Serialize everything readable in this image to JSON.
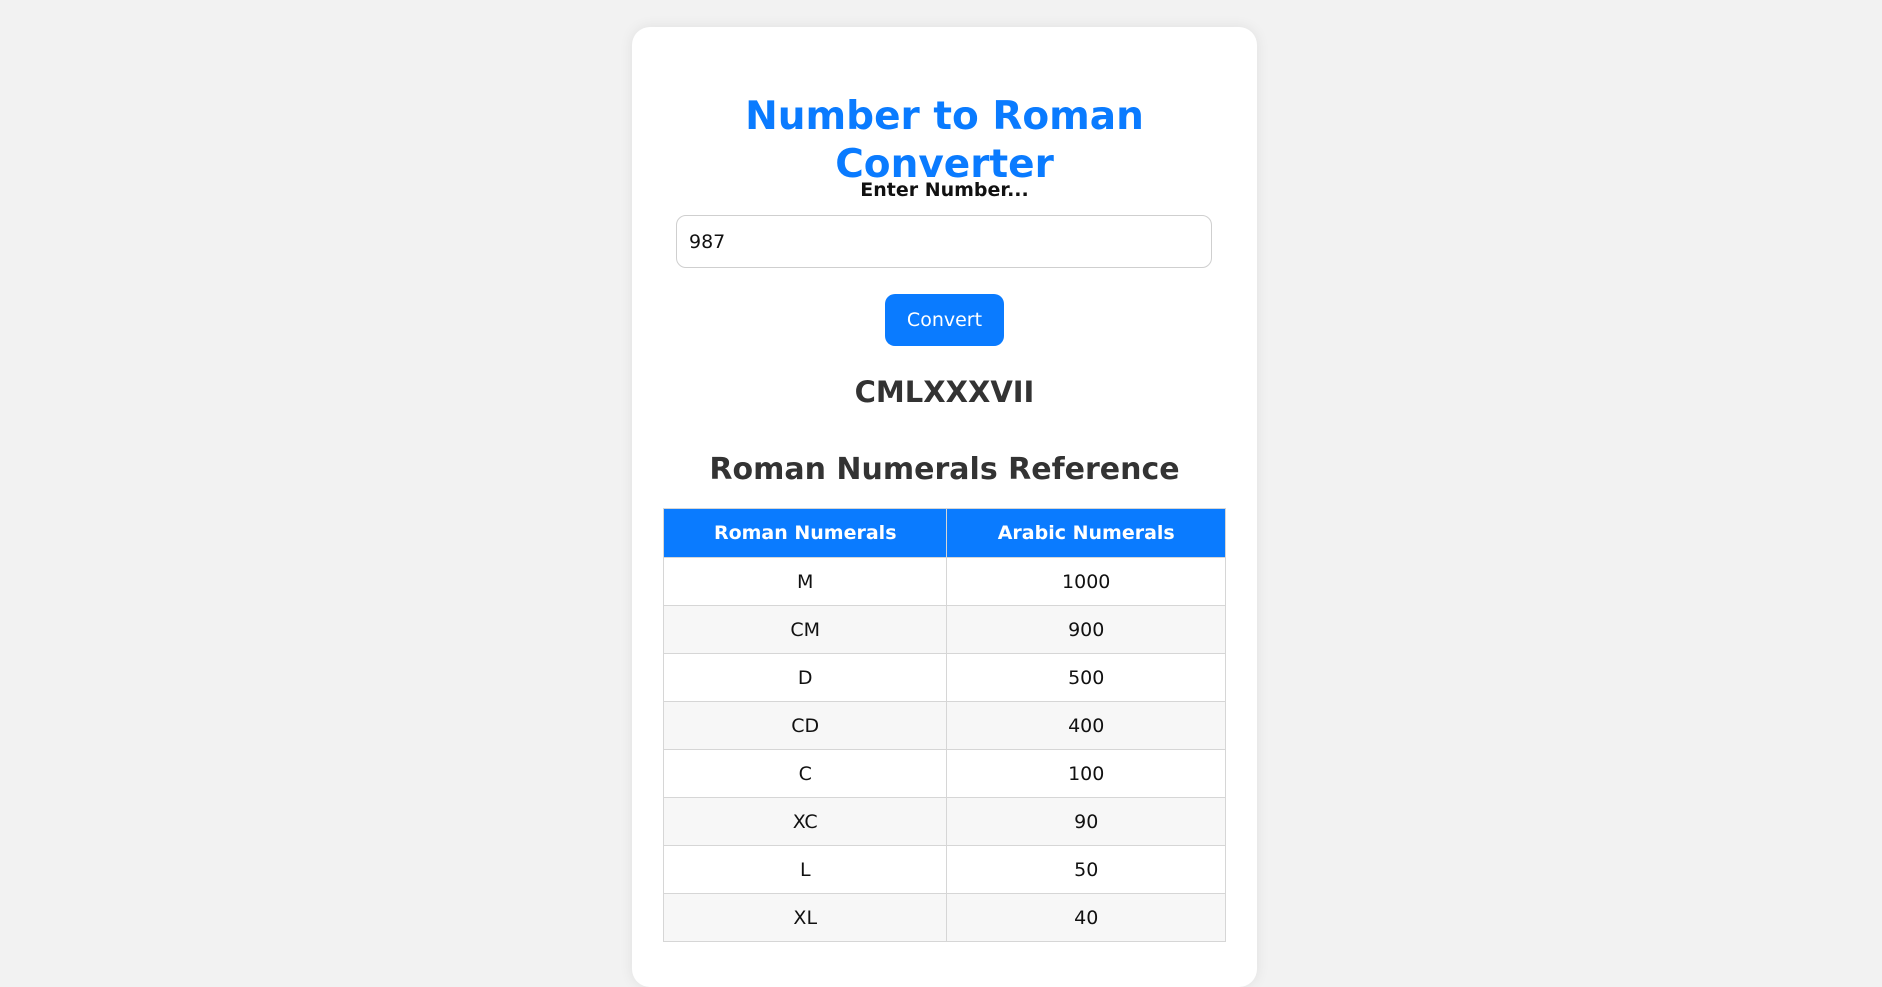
{
  "app": {
    "title": "Number to Roman Converter",
    "input_label": "Enter Number...",
    "input_value": "987",
    "button_label": "Convert",
    "result": "CMLXXXVII"
  },
  "reference": {
    "heading": "Roman Numerals Reference",
    "columns": [
      "Roman Numerals",
      "Arabic Numerals"
    ],
    "rows": [
      [
        "M",
        "1000"
      ],
      [
        "CM",
        "900"
      ],
      [
        "D",
        "500"
      ],
      [
        "CD",
        "400"
      ],
      [
        "C",
        "100"
      ],
      [
        "XC",
        "90"
      ],
      [
        "L",
        "50"
      ],
      [
        "XL",
        "40"
      ]
    ]
  }
}
